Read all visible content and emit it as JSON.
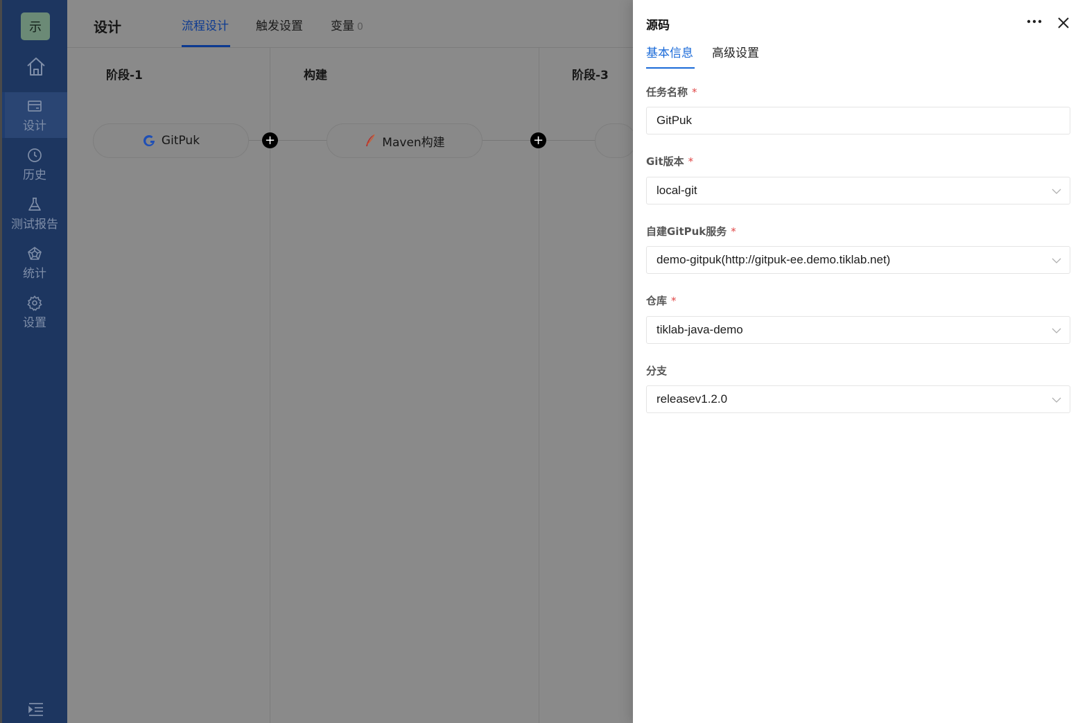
{
  "sidebar": {
    "logo_text": "示",
    "items": [
      {
        "label": "设计",
        "icon": "card-icon",
        "active": true
      },
      {
        "label": "历史",
        "icon": "clock-icon"
      },
      {
        "label": "测试报告",
        "icon": "flask-icon"
      },
      {
        "label": "统计",
        "icon": "chart-pentagon-icon"
      },
      {
        "label": "设置",
        "icon": "gear-icon"
      }
    ]
  },
  "header": {
    "title": "设计",
    "tabs": [
      {
        "label": "流程设计",
        "active": true
      },
      {
        "label": "触发设置"
      },
      {
        "label": "变量",
        "count": "0"
      }
    ]
  },
  "pipeline": {
    "stages": [
      {
        "title": "阶段-1",
        "task": {
          "name": "GitPuk",
          "icon": "gitpuk-icon"
        }
      },
      {
        "title": "构建",
        "task": {
          "name": "Maven构建",
          "icon": "maven-feather-icon"
        }
      },
      {
        "title": "阶段-3",
        "task": {
          "name": ""
        }
      }
    ]
  },
  "drawer": {
    "title": "源码",
    "tabs": [
      {
        "label": "基本信息",
        "active": true
      },
      {
        "label": "高级设置"
      }
    ],
    "fields": [
      {
        "label": "任务名称",
        "required": true,
        "value": "GitPuk",
        "type": "input"
      },
      {
        "label": "Git版本",
        "required": true,
        "value": "local-git",
        "type": "select"
      },
      {
        "label": "自建GitPuk服务",
        "required": true,
        "value": "demo-gitpuk(http://gitpuk-ee.demo.tiklab.net)",
        "type": "select"
      },
      {
        "label": "仓库",
        "required": true,
        "value": "tiklab-java-demo",
        "type": "select"
      },
      {
        "label": "分支",
        "required": false,
        "value": "releasev1.2.0",
        "type": "select"
      }
    ],
    "required_mark": "*"
  },
  "colors": {
    "sidebar_bg": "#1d3660",
    "accent": "#1a6ad8",
    "required": "#e04848",
    "overlay": "#8a8a8a"
  }
}
